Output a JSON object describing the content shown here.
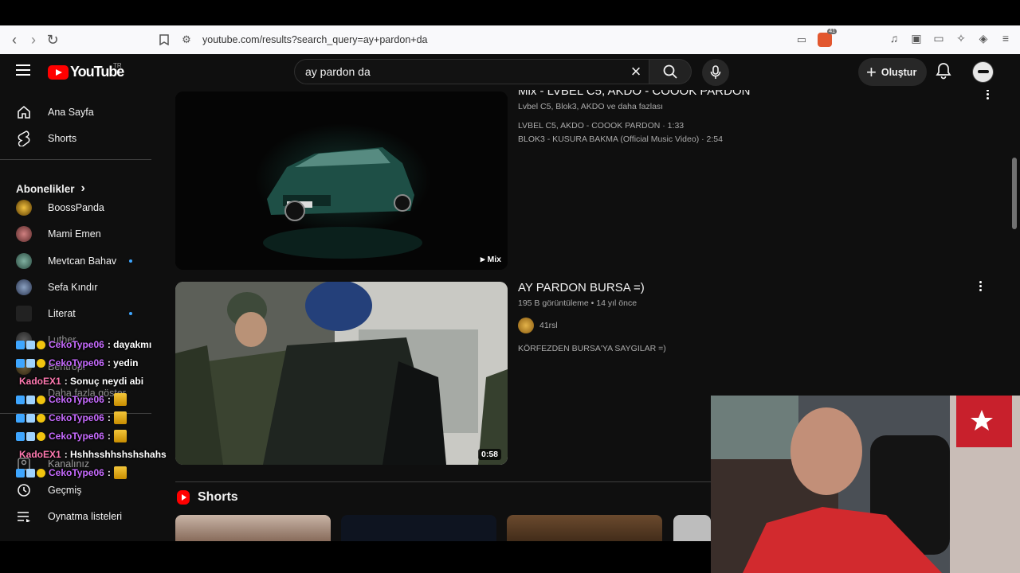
{
  "browser": {
    "url": "youtube.com/results?search_query=ay+pardon+da",
    "brave_badge": "41"
  },
  "masthead": {
    "logo_text": "YouTube",
    "country_code": "TR",
    "search_value": "ay pardon da",
    "create_label": "Oluştur"
  },
  "sidebar": {
    "home": "Ana Sayfa",
    "shorts": "Shorts",
    "subscriptions_header": "Abonelikler",
    "subscriptions": [
      {
        "name": "BoossPanda"
      },
      {
        "name": "Mami Emen"
      },
      {
        "name": "Mevtcan Bahav"
      },
      {
        "name": "Sefa Kındır"
      },
      {
        "name": "Literat"
      },
      {
        "name": "Luther"
      },
      {
        "name": "Bentrop!"
      }
    ],
    "show_more": "Daha fazla göster",
    "your_channel": "Kanalınız",
    "history": "Geçmiş",
    "playlists": "Oynatma listeleri"
  },
  "chat": [
    {
      "user": "CekoType06",
      "msg": ": dayakmı"
    },
    {
      "user": "CekoType06",
      "msg": ": yedin"
    },
    {
      "user": "KadoEX1",
      "msg": ": Sonuç neydi abi"
    },
    {
      "user": "CekoType06",
      "msg": ":"
    },
    {
      "user": "CekoType06",
      "msg": ":"
    },
    {
      "user": "CekoType06",
      "msg": ":"
    },
    {
      "user": "KadoEX1",
      "msg": ": Hshhsshhshshshahs"
    },
    {
      "user": "CekoType06",
      "msg": ":"
    }
  ],
  "results": [
    {
      "title": "Mix - LVBEL C5, AKDO - COOOK PARDON",
      "channels": "Lvbel C5, Blok3, AKDO ve daha fazlası",
      "track1": "LVBEL C5, AKDO - COOOK PARDON · 1:33",
      "track2": "BLOK3 - KUSURA BAKMA (Official Music Video) · 2:54",
      "badge": "Mix"
    },
    {
      "title": "AY PARDON BURSA =)",
      "views": "195 B görüntüleme",
      "age": "14 yıl önce",
      "channel": "41rsl",
      "description": "KÖRFEZDEN BURSA'YA SAYGILAR =)",
      "duration": "0:58"
    }
  ],
  "shorts_header": "Shorts"
}
